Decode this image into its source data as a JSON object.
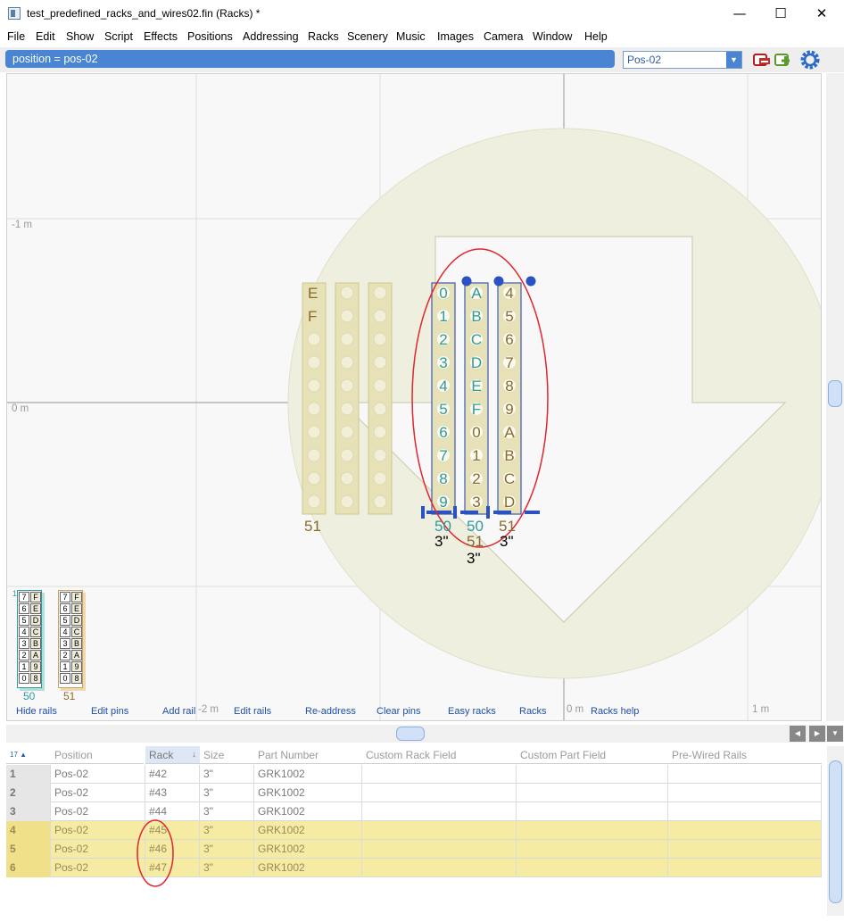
{
  "window": {
    "title": "test_predefined_racks_and_wires02.fin (Racks) *",
    "minimize": "—",
    "maximize": "☐",
    "close": "✕"
  },
  "menu": [
    "File",
    "Edit",
    "Show",
    "Script",
    "Effects",
    "Positions",
    "Addressing",
    "Racks",
    "Scenery",
    "Music",
    "Images",
    "Camera",
    "Window",
    "Help"
  ],
  "toolbar": {
    "filter": "position = pos-02",
    "position_select": "Pos-02"
  },
  "canvas": {
    "axis_labels": [
      "-1 m",
      "0 m",
      "-2 m",
      "0 m",
      "1 m"
    ],
    "links": [
      "Hide rails",
      "Edit pins",
      "Add rail",
      "Edit rails",
      "Re-address",
      "Clear pins",
      "Easy racks",
      "Racks",
      "Racks help"
    ],
    "left_racks": {
      "top_letters": [
        "E",
        "F"
      ],
      "label": "51"
    },
    "selected_racks": [
      {
        "pins": [
          "0",
          "1",
          "2",
          "3",
          "4",
          "5",
          "6",
          "7",
          "8",
          "9"
        ],
        "label": "50",
        "size": "3\"",
        "color": "#2f9a9a"
      },
      {
        "pins": [
          "A",
          "B",
          "C",
          "D",
          "E",
          "F",
          "0",
          "1",
          "2",
          "3"
        ],
        "label": "50",
        "sub": "51",
        "size": "3\"",
        "color": "#2f9a9a"
      },
      {
        "pins": [
          "4",
          "5",
          "6",
          "7",
          "8",
          "9",
          "A",
          "B",
          "C",
          "D"
        ],
        "label": "51",
        "size": "3\"",
        "color": "#8a6a2a"
      }
    ],
    "legend_racks": [
      {
        "label": "50",
        "cells": [
          [
            "7",
            "F"
          ],
          [
            "6",
            "E"
          ],
          [
            "5",
            "D"
          ],
          [
            "4",
            "C"
          ],
          [
            "3",
            "B"
          ],
          [
            "2",
            "A"
          ],
          [
            "1",
            "9"
          ],
          [
            "0",
            "8"
          ]
        ]
      },
      {
        "label": "51",
        "cells": [
          [
            "7",
            "F"
          ],
          [
            "6",
            "E"
          ],
          [
            "5",
            "D"
          ],
          [
            "4",
            "C"
          ],
          [
            "3",
            "B"
          ],
          [
            "2",
            "A"
          ],
          [
            "1",
            "9"
          ],
          [
            "0",
            "8"
          ]
        ]
      }
    ],
    "corner_number": "1"
  },
  "grid": {
    "corner": "17",
    "columns": [
      "Position",
      "Rack",
      "Size",
      "Part Number",
      "Custom Rack Field",
      "Custom Part Field",
      "Pre-Wired Rails"
    ],
    "rows": [
      {
        "n": "1",
        "position": "Pos-02",
        "rack": "#42",
        "size": "3\"",
        "part": "GRK1002",
        "highlight": false
      },
      {
        "n": "2",
        "position": "Pos-02",
        "rack": "#43",
        "size": "3\"",
        "part": "GRK1002",
        "highlight": false
      },
      {
        "n": "3",
        "position": "Pos-02",
        "rack": "#44",
        "size": "3\"",
        "part": "GRK1002",
        "highlight": false
      },
      {
        "n": "4",
        "position": "Pos-02",
        "rack": "#45",
        "size": "3\"",
        "part": "GRK1002",
        "highlight": true
      },
      {
        "n": "5",
        "position": "Pos-02",
        "rack": "#46",
        "size": "3\"",
        "part": "GRK1002",
        "highlight": true
      },
      {
        "n": "6",
        "position": "Pos-02",
        "rack": "#47",
        "size": "3\"",
        "part": "GRK1002",
        "highlight": true
      }
    ]
  },
  "colors": {
    "accent": "#4a85d4",
    "highlight_row": "#f5eba2",
    "annotation": "#e0262e"
  }
}
